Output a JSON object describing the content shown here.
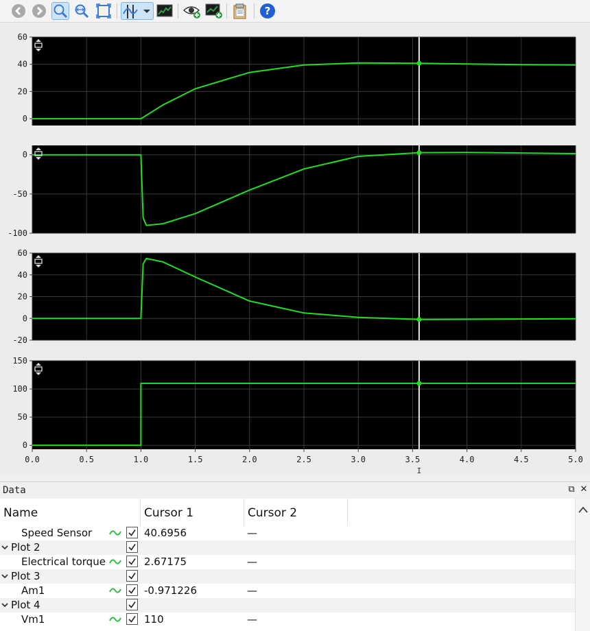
{
  "toolbar": {
    "icons": [
      "back-icon",
      "forward-icon",
      "zoom-icon",
      "zoom-x-icon",
      "fit-icon",
      "cursor-measure-icon",
      "dropdown-icon",
      "plot-icon",
      "visibility-icon",
      "add-plot-icon",
      "clipboard-icon",
      "help-icon"
    ],
    "colors": {
      "blue": "#3c78d8",
      "green": "#2f9e44",
      "help": "#1f5fd6"
    }
  },
  "chart_data": [
    {
      "type": "line",
      "series": [
        {
          "x": [
            0,
            1,
            1.2,
            1.5,
            2,
            2.5,
            3,
            3.56,
            4,
            4.5,
            5
          ],
          "y": [
            0,
            0,
            10,
            22,
            34,
            39.5,
            41,
            40.7,
            40.2,
            39.7,
            39.5
          ]
        }
      ],
      "ylim": [
        -5,
        60
      ],
      "yticks": [
        "60",
        "40",
        "20",
        "0"
      ],
      "xlim": [
        0,
        5
      ],
      "grid": true,
      "color": "#22dd22"
    },
    {
      "type": "line",
      "series": [
        {
          "x": [
            0,
            1,
            1.02,
            1.05,
            1.2,
            1.5,
            2,
            2.5,
            3,
            3.56,
            4,
            5
          ],
          "y": [
            0,
            0,
            -80,
            -90,
            -88,
            -75,
            -45,
            -18,
            -2,
            2.7,
            3,
            1.5
          ]
        }
      ],
      "ylim": [
        -100,
        12
      ],
      "yticks": [
        "0",
        "-50",
        "-100"
      ],
      "xlim": [
        0,
        5
      ],
      "grid": true,
      "color": "#22dd22"
    },
    {
      "type": "line",
      "series": [
        {
          "x": [
            0,
            1,
            1.02,
            1.05,
            1.2,
            1.5,
            2,
            2.5,
            3,
            3.56,
            4,
            5
          ],
          "y": [
            0,
            0,
            50,
            55,
            52,
            38,
            16,
            5,
            1,
            -0.97,
            -0.8,
            -0.3
          ]
        }
      ],
      "ylim": [
        -20,
        60
      ],
      "yticks": [
        "60",
        "40",
        "20",
        "0",
        "-20"
      ],
      "xlim": [
        0,
        5
      ],
      "grid": true,
      "color": "#22dd22"
    },
    {
      "type": "line",
      "series": [
        {
          "x": [
            0,
            1,
            1,
            5
          ],
          "y": [
            0,
            0,
            110,
            110
          ]
        }
      ],
      "ylim": [
        -7,
        150
      ],
      "yticks": [
        "150",
        "100",
        "50",
        "0"
      ],
      "xlim": [
        0,
        5
      ],
      "grid": true,
      "color": "#22dd22"
    }
  ],
  "xaxis": {
    "ticks": [
      "0.0",
      "0.5",
      "1.0",
      "1.5",
      "2.0",
      "2.5",
      "3.0",
      "3.5",
      "4.0",
      "4.5",
      "5.0"
    ]
  },
  "cursor": {
    "x": 3.56,
    "values": [
      40.6956,
      2.67175,
      -0.971226,
      110
    ],
    "label": "I"
  },
  "data_panel": {
    "title": "Data",
    "columns": [
      "Name",
      "Cursor 1",
      "Cursor 2"
    ],
    "rows": [
      {
        "name": "Speed Sensor",
        "group": false,
        "checked": true,
        "cursor1": "40.6956",
        "cursor2": "—"
      },
      {
        "name": "Plot 2",
        "group": true,
        "checked": true,
        "cursor1": "",
        "cursor2": ""
      },
      {
        "name": "Electrical torque",
        "group": false,
        "checked": true,
        "cursor1": "2.67175",
        "cursor2": "—"
      },
      {
        "name": "Plot 3",
        "group": true,
        "checked": true,
        "cursor1": "",
        "cursor2": ""
      },
      {
        "name": "Am1",
        "group": false,
        "checked": true,
        "cursor1": "-0.971226",
        "cursor2": "—"
      },
      {
        "name": "Plot 4",
        "group": true,
        "checked": true,
        "cursor1": "",
        "cursor2": ""
      },
      {
        "name": "Vm1",
        "group": false,
        "checked": true,
        "cursor1": "110",
        "cursor2": "—"
      }
    ]
  }
}
